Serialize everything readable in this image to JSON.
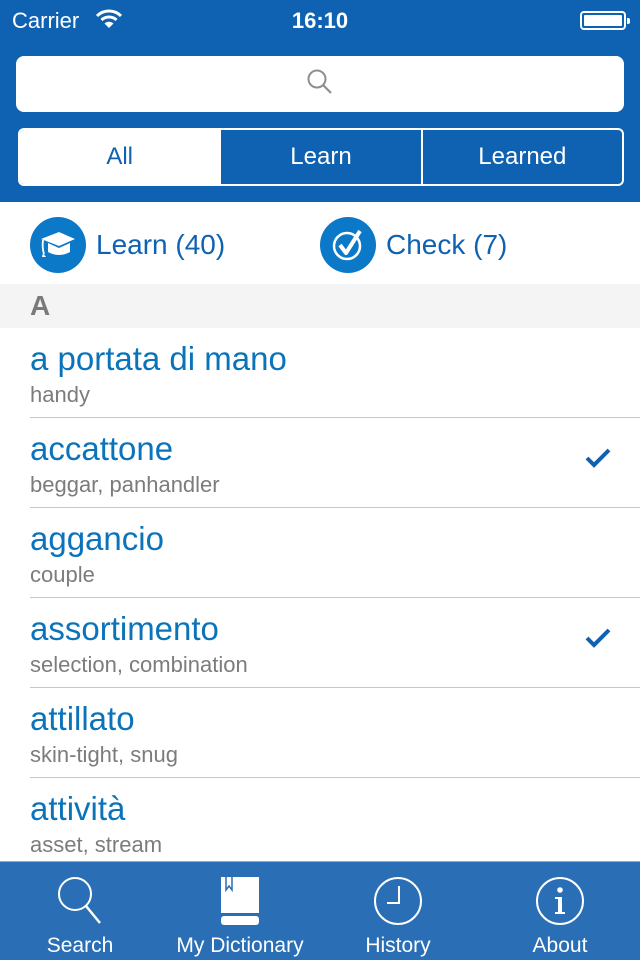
{
  "status_bar": {
    "carrier": "Carrier",
    "time": "16:10",
    "battery_percent": 100
  },
  "search": {
    "placeholder": "",
    "value": ""
  },
  "segments": [
    {
      "label": "All",
      "active": true
    },
    {
      "label": "Learn",
      "active": false
    },
    {
      "label": "Learned",
      "active": false
    }
  ],
  "actions": {
    "learn": {
      "label": "Learn (40)",
      "icon": "graduation-cap-icon"
    },
    "check": {
      "label": "Check (7)",
      "icon": "check-circle-icon"
    }
  },
  "section_header": "A",
  "entries": [
    {
      "word": "a portata di mano",
      "translation": "handy",
      "learned": false
    },
    {
      "word": "accattone",
      "translation": "beggar, panhandler",
      "learned": true
    },
    {
      "word": "aggancio",
      "translation": "couple",
      "learned": false
    },
    {
      "word": "assortimento",
      "translation": "selection, combination",
      "learned": true
    },
    {
      "word": "attillato",
      "translation": "skin-tight, snug",
      "learned": false
    },
    {
      "word": "attività",
      "translation": "asset, stream",
      "learned": false
    }
  ],
  "tabbar": [
    {
      "label": "Search",
      "icon": "search-icon"
    },
    {
      "label": "My Dictionary",
      "icon": "book-icon",
      "active": true
    },
    {
      "label": "History",
      "icon": "clock-icon"
    },
    {
      "label": "About",
      "icon": "info-icon"
    }
  ],
  "colors": {
    "brand": "#0f62b1",
    "tabbar": "#2a6fb5",
    "word": "#0b73ba",
    "icon_circle": "#0b78c8"
  }
}
